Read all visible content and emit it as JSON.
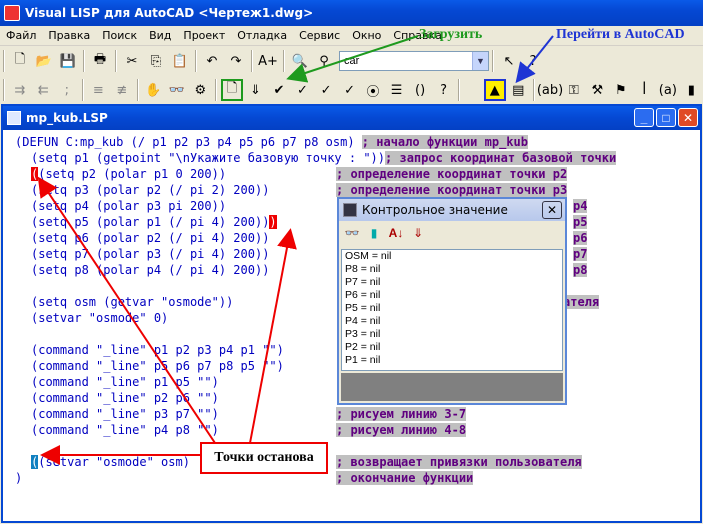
{
  "window": {
    "title": "Visual LISP для AutoCAD <Чертеж1.dwg>"
  },
  "menu": [
    "Файл",
    "Правка",
    "Поиск",
    "Вид",
    "Проект",
    "Отладка",
    "Сервис",
    "Окно",
    "Справка"
  ],
  "toolbar": {
    "search_value": "car"
  },
  "annotations": {
    "load": "Загрузить",
    "goto_autocad": "Перейти в AutoCAD",
    "breakpoints": "Точки останова"
  },
  "editor": {
    "title": "mp_kub.LSP"
  },
  "code_lines": [
    "(DEFUN C:mp_kub (/ p1 p2 p3 p4 p5 p6 p7 p8 osm)",
    "(setq p1 (getpoint \"\\nУкажите базовую точку : \"))",
    "(setq p2 (polar p1 0 200))",
    "(setq p3 (polar p2 (/ pi 2) 200))",
    "(setq p4 (polar p3 pi 200))",
    "(setq p5 (polar p1 (/ pi 4) 200))",
    "(setq p6 (polar p2 (/ pi 4) 200))",
    "(setq p7 (polar p3 (/ pi 4) 200))",
    "(setq p8 (polar p4 (/ pi 4) 200))",
    "(setq osm (getvar \"osmode\"))",
    "(setvar \"osmode\" 0)",
    "(command \"_line\" p1 p2 p3 p4 p1 \"\")",
    "(command \"_line\" p5 p6 p7 p8 p5 \"\")",
    "(command \"_line\" p1 p5 \"\")",
    "(command \"_line\" p2 p6 \"\")",
    "(command \"_line\" p3 p7 \"\")",
    "(command \"_line\" p4 p8 \"\")",
    "(setvar \"osmode\" osm)",
    ")"
  ],
  "comments": {
    "c0": "; начало функции mp_kub",
    "c1": "; запрос координат базовой точки",
    "c2": "; определение координат точки p2",
    "c3": "; определение координат точки p3",
    "c4": "p4",
    "c5": "p5",
    "c6": "p6",
    "c7": "p7",
    "c8": "p8",
    "c9": "ателя",
    "c15": "; рисуем линию 3-7",
    "c16": "; рисуем линию 4-8",
    "c17": "; возвращает привязки пользователя",
    "c18": "; окончание функции"
  },
  "watch": {
    "title": "Контрольное значение",
    "items": [
      "OSM = nil",
      "P8 = nil",
      "P7 = nil",
      "P6 = nil",
      "P5 = nil",
      "P4 = nil",
      "P3 = nil",
      "P2 = nil",
      "P1 = nil"
    ]
  }
}
